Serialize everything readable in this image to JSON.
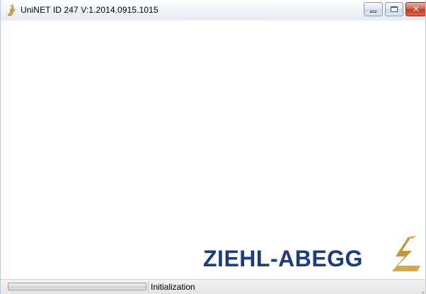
{
  "window": {
    "title": "UniNET ID 247 V:1.2014.0915.1015",
    "controls": {
      "minimize_icon": "minimize-icon",
      "maximize_icon": "maximize-icon",
      "close_icon": "close-icon",
      "close_glyph": "✕"
    }
  },
  "logo": {
    "text": "ZIEHL-ABEGG",
    "text_color": "#1c3c7e",
    "mark_color": "#d1a84a"
  },
  "statusbar": {
    "progress_fraction": 0,
    "status_text": "Initialization"
  }
}
